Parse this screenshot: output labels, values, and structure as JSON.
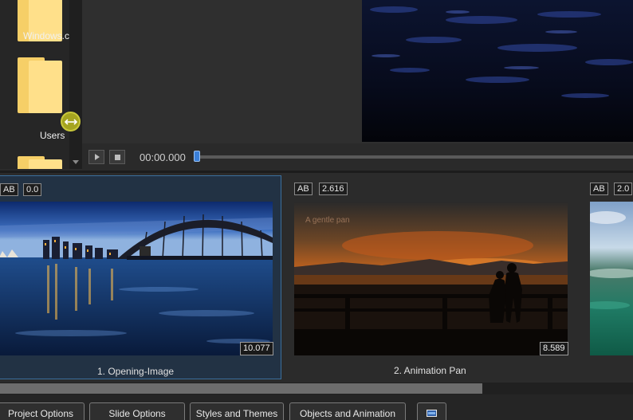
{
  "folders": [
    {
      "label": "Windows.c"
    },
    {
      "label": "Users"
    }
  ],
  "player": {
    "time": "00:00.000"
  },
  "slides": [
    {
      "index_title": "1. Opening-Image",
      "badge_label": "AB",
      "start": "0.0",
      "duration": "10.077",
      "selected": true
    },
    {
      "index_title": "2. Animation Pan",
      "badge_label": "AB",
      "start": "2.616",
      "duration": "8.589",
      "selected": false,
      "overlay_text": "A gentle pan"
    },
    {
      "index_title": "",
      "badge_label": "AB",
      "start": "2.0",
      "duration": "",
      "selected": false
    }
  ],
  "toolbar": {
    "tabs": [
      {
        "label": "Project Options"
      },
      {
        "label": "Slide Options"
      },
      {
        "label": "Styles and Themes"
      },
      {
        "label": "Objects and Animation"
      }
    ],
    "extra_icon": "slideshow-icon"
  },
  "colors": {
    "selection_bg": "#223244",
    "selection_border": "#3b6f9d",
    "folder": "#ffe08a",
    "resize_handle": "#a5a420",
    "seek_thumb": "#3a7fd8"
  }
}
